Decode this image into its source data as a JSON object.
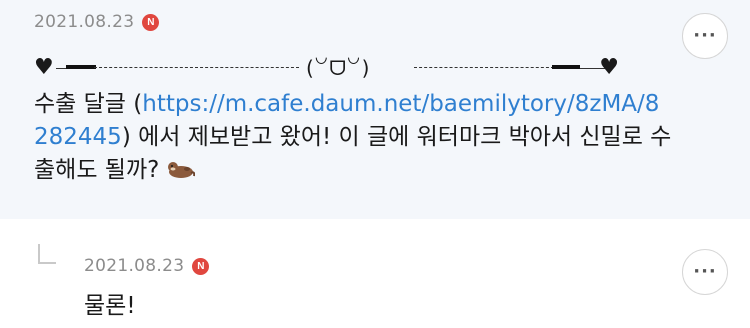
{
  "post": {
    "date": "2021.08.23",
    "badge": "N",
    "more_label": "···",
    "decoration": {
      "heart": "♥",
      "face": "(꒡ᗜ꒡)"
    },
    "text_prefix": "수출 달글 (",
    "link": "https://m.cafe.daum.net/baemilytory/8zMA/8282445",
    "text_suffix": ") 에서 제보받고 왔어! 이 글에 워터마크 박아서 신밀로 수출해도 될까? ",
    "emoji_icon": "otter-icon"
  },
  "reply": {
    "date": "2021.08.23",
    "badge": "N",
    "more_label": "···",
    "text": "물론!"
  }
}
